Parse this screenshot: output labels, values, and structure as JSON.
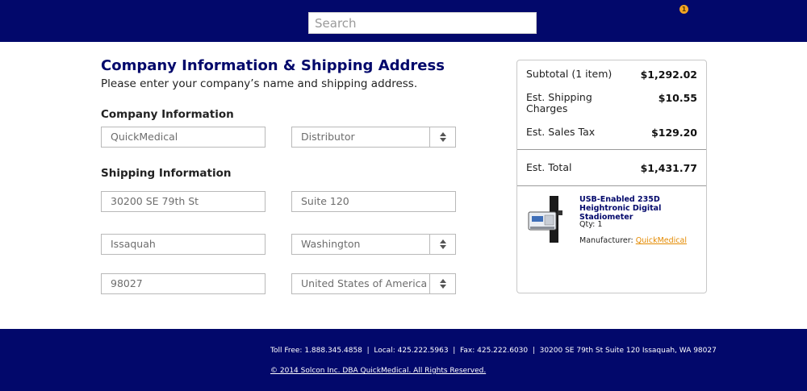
{
  "header": {
    "search_placeholder": "Search",
    "cart_count": "1"
  },
  "form": {
    "title": "Company Information & Shipping Address",
    "subtitle": "Please enter your company’s name and shipping address.",
    "company_section": "Company Information",
    "company_name": "QuickMedical",
    "company_type": "Distributor",
    "shipping_section": "Shipping Information",
    "address1": "30200 SE 79th St",
    "address2": "Suite 120",
    "city": "Issaquah",
    "state": "Washington",
    "zip": "98027",
    "country": "United States of America"
  },
  "summary": {
    "subtotal_label": "Subtotal (1 item)",
    "subtotal_value": "$1,292.02",
    "shipping_label": "Est. Shipping Charges",
    "shipping_value": "$10.55",
    "tax_label": "Est. Sales Tax",
    "tax_value": "$129.20",
    "total_label": "Est. Total",
    "total_value": "$1,431.77",
    "product": {
      "title": "USB-Enabled 235D Heightronic Digital Stadiometer",
      "qty": "Qty: 1",
      "manufacturer_label": "Manufacturer:",
      "manufacturer_link": "QuickMedical"
    }
  },
  "footer": {
    "contact": "Toll Free: 1.888.345.4858  |  Local: 425.222.5963  |  Fax: 425.222.6030  |  30200 SE 79th St Suite 120 Issaquah, WA 98027",
    "copyright": "© 2014 Solcon Inc. DBA QuickMedical. All Rights Reserved. "
  },
  "colors": {
    "brand_navy": "#02086b",
    "accent_orange": "#f5a623",
    "link_orange": "#e48a00"
  },
  "icons": [
    "cart-badge-icon",
    "select-arrows-icon",
    "product-stadiometer-image"
  ]
}
